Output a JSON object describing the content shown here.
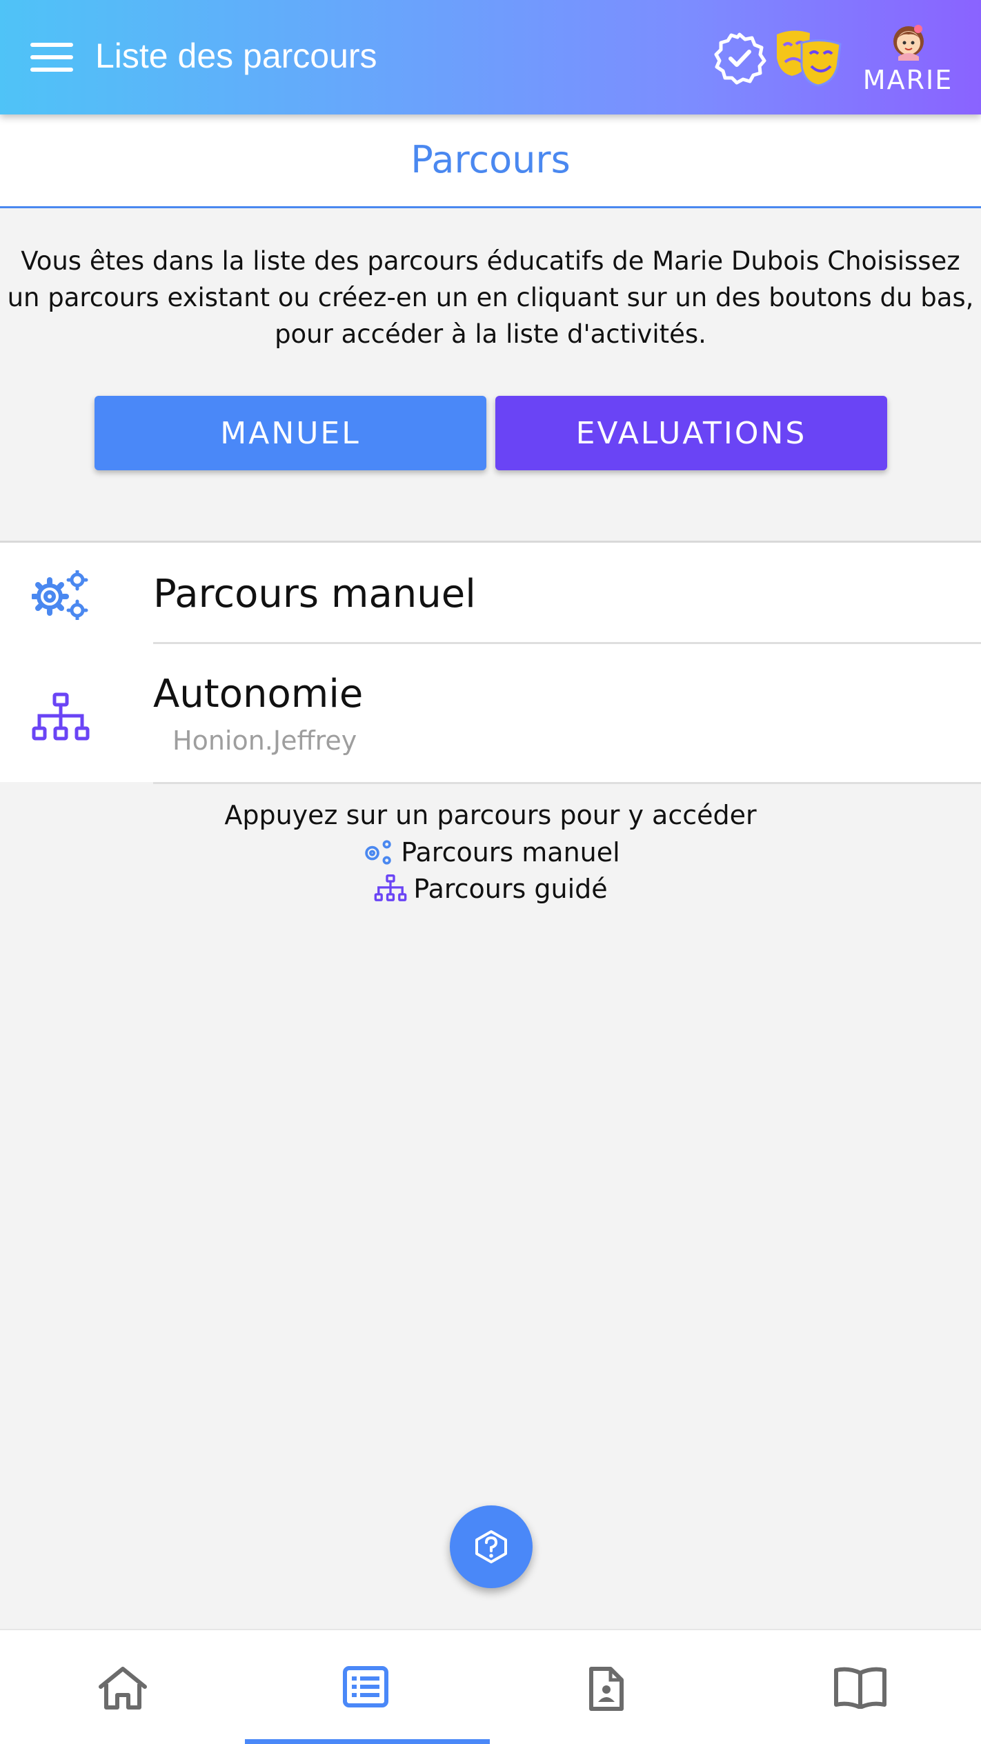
{
  "app_bar": {
    "title": "Liste des parcours",
    "user_name": "MARIE",
    "icons": [
      "menu-icon",
      "certified-badge-icon",
      "theater-masks-icon",
      "avatar-girl-icon"
    ]
  },
  "tab": {
    "label": "Parcours"
  },
  "intro": {
    "text": "Vous êtes dans la liste des parcours éducatifs de Marie Dubois Choisissez un parcours existant ou créez-en un en cliquant sur un des boutons du bas, pour accéder à la liste d'activités."
  },
  "buttons": {
    "manuel": "MANUEL",
    "evaluations": "EVALUATIONS"
  },
  "parcours": [
    {
      "title": "Parcours manuel",
      "subtitle": "",
      "icon": "gears-icon"
    },
    {
      "title": "Autonomie",
      "subtitle": "Honion.Jeffrey",
      "icon": "sitemap-icon"
    }
  ],
  "legend": {
    "title": "Appuyez sur un parcours pour y accéder",
    "manuel": "Parcours manuel",
    "guide": "Parcours guidé"
  },
  "fab": {
    "icon": "question-icon"
  },
  "bottom_nav": {
    "items": [
      "home-icon",
      "list-icon",
      "file-user-icon",
      "book-icon"
    ],
    "active_index": 1
  },
  "colors": {
    "primary_blue": "#4a88f8",
    "purple": "#6a44f5",
    "gradient_start": "#4fc3f7",
    "gradient_end": "#8a63ff",
    "gold": "#f5c518",
    "nav_icon_gray": "#6b6b6b"
  }
}
